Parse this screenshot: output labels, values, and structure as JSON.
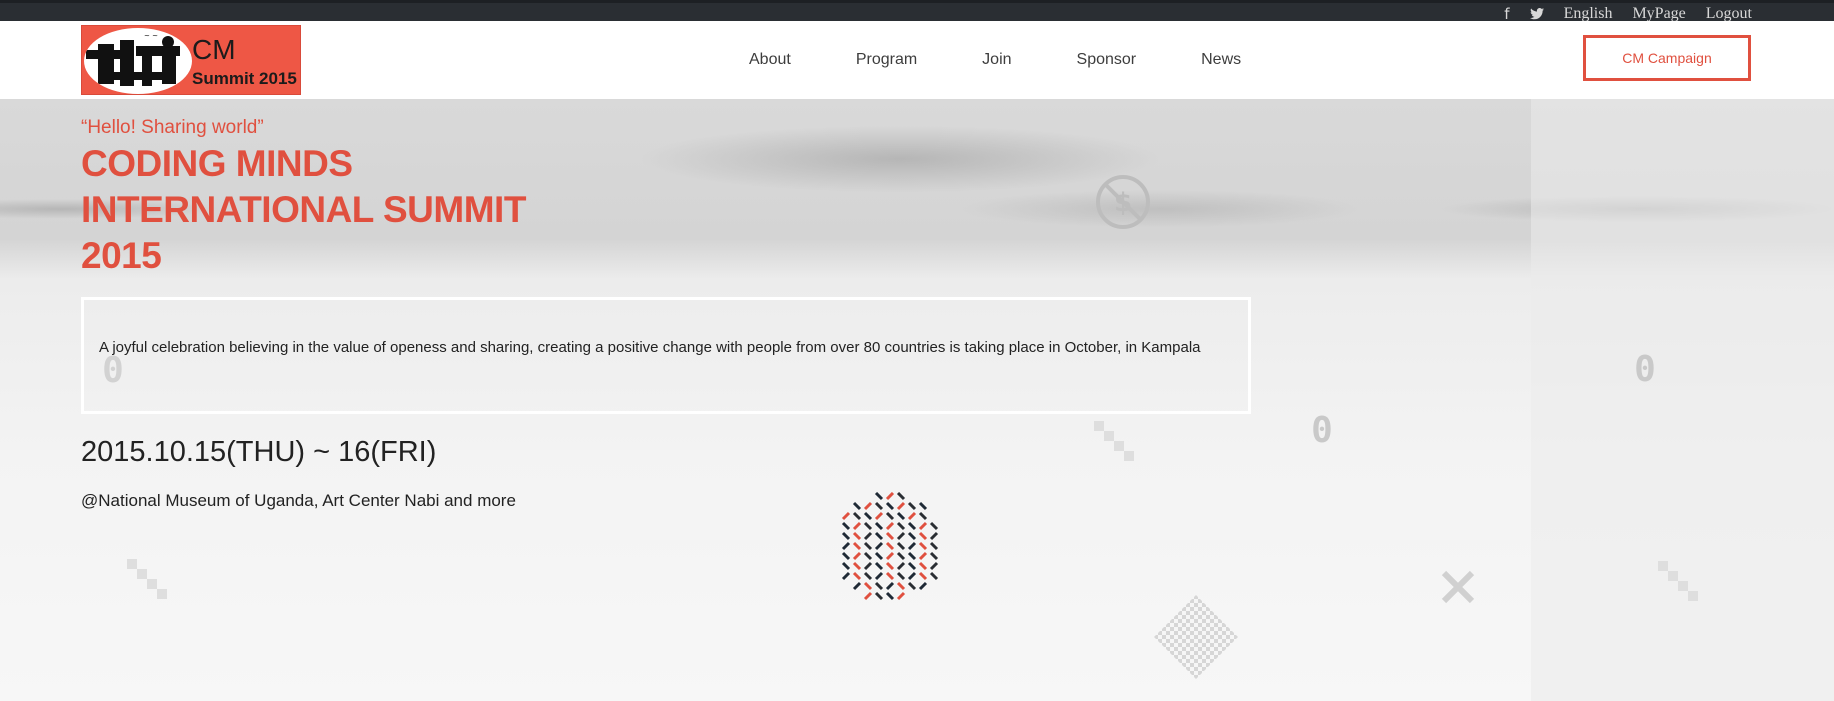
{
  "topbar": {
    "social": [
      "facebook-icon",
      "twitter-icon"
    ],
    "links": [
      "English",
      "MyPage",
      "Logout"
    ]
  },
  "logo": {
    "line1": "CM",
    "line2": "Summit 2015"
  },
  "nav": {
    "items": [
      "About",
      "Program",
      "Join",
      "Sponsor",
      "News"
    ]
  },
  "campaign_button": "CM Campaign",
  "hero": {
    "tagline": "“Hello! Sharing world”",
    "title_lines": [
      "CODING MINDS",
      "INTERNATIONAL SUMMIT",
      "2015"
    ],
    "description": "A joyful celebration believing in the value of openess and sharing, creating a positive change with people from over 80 countries is taking place in October, in Kampala",
    "date": "2015.10.15(THU) ~ 16(FRI)",
    "venue": "@National Museum of Uganda, Art Center Nabi and more"
  },
  "colors": {
    "accent": "#e0503f",
    "topbar": "#2a2e33"
  }
}
